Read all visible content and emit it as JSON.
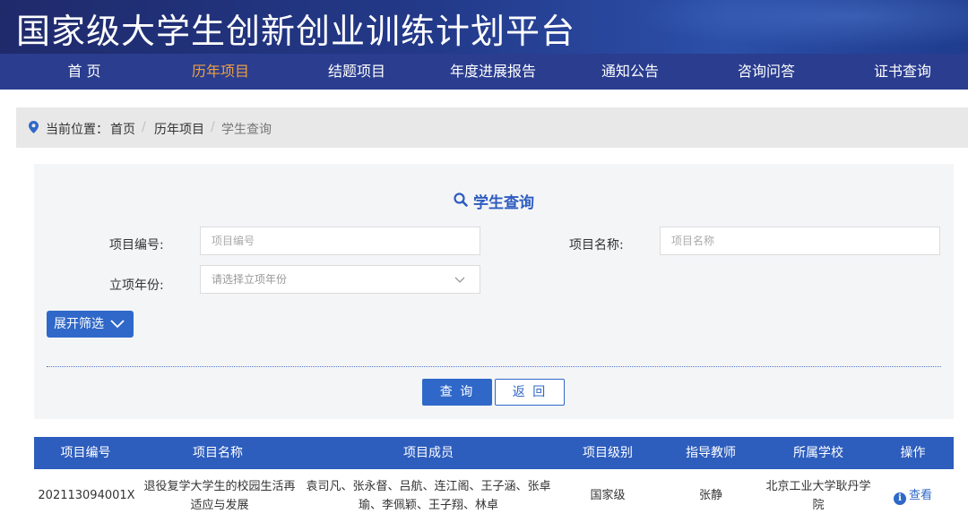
{
  "header": {
    "title": "国家级大学生创新创业训练计划平台"
  },
  "nav": {
    "items": [
      {
        "label": "首 页"
      },
      {
        "label": "历年项目"
      },
      {
        "label": "结题项目"
      },
      {
        "label": "年度进展报告"
      },
      {
        "label": "通知公告"
      },
      {
        "label": "咨询问答"
      },
      {
        "label": "证书查询"
      }
    ],
    "active_index": 1
  },
  "breadcrumb": {
    "prefix": "当前位置：",
    "items": [
      "首页",
      "历年项目",
      "学生查询"
    ],
    "separator": "/"
  },
  "search": {
    "title": "学生查询",
    "fields": {
      "project_no": {
        "label": "项目编号:",
        "placeholder": "项目编号",
        "value": ""
      },
      "project_name": {
        "label": "项目名称:",
        "placeholder": "项目名称",
        "value": ""
      },
      "year": {
        "label": "立项年份:",
        "placeholder": "请选择立项年份",
        "value": ""
      }
    },
    "expand_label": "展开筛选",
    "query_label": "查 询",
    "back_label": "返 回"
  },
  "table": {
    "headers": [
      "项目编号",
      "项目名称",
      "项目成员",
      "项目级别",
      "指导教师",
      "所属学校",
      "操作"
    ],
    "rows": [
      {
        "project_no": "202113094001X",
        "project_name": "退役复学大学生的校园生活再适应与发展",
        "members": "袁司凡、张永督、吕航、连江阁、王子涵、张卓瑜、李佩颖、王子翔、林卓",
        "level": "国家级",
        "teacher": "张静",
        "school": "北京工业大学耿丹学院",
        "action": "查看"
      }
    ]
  },
  "colors": {
    "banner": "#233a8a",
    "nav_bg": "#2a3d8f",
    "nav_active": "#f0a040",
    "primary": "#2f68c8",
    "table_head": "#2d5dbd"
  }
}
